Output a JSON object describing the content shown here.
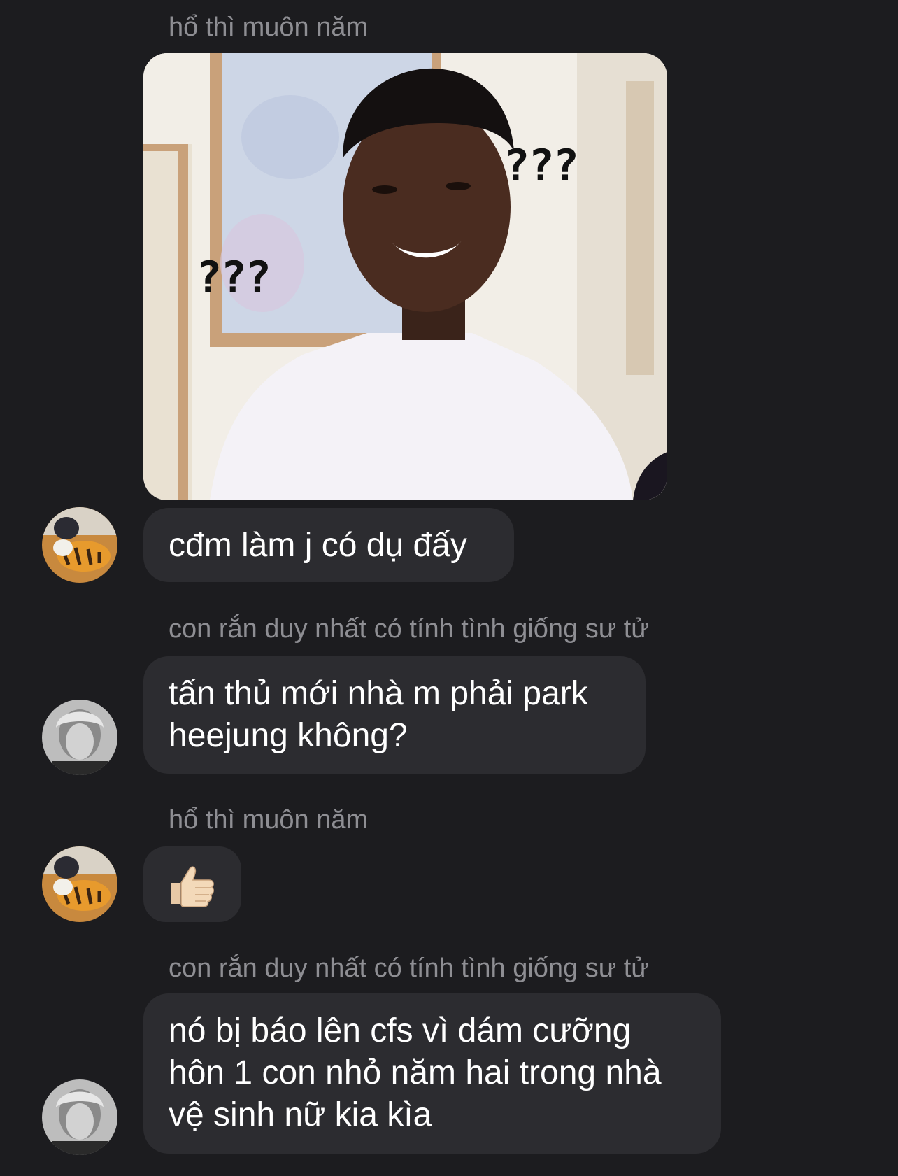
{
  "colors": {
    "background": "#1c1c1f",
    "bubble": "#2c2c30",
    "sender_name": "#8e8e93",
    "message_text": "#ffffff"
  },
  "messages": [
    {
      "sender": "hổ thì muôn năm",
      "type": "image",
      "image_captions": [
        "???",
        "???"
      ]
    },
    {
      "type": "text",
      "text": "cđm làm j có dụ đấy"
    },
    {
      "sender": "con rắn duy nhất có tính tình giống sư tử",
      "type": "text",
      "lines": [
        "tấn thủ mới nhà m phải park",
        "heejung không?"
      ]
    },
    {
      "sender": "hổ thì muôn năm",
      "type": "emoji",
      "icon": "thumbs-up-icon"
    },
    {
      "sender": "con rắn duy nhất có tính tình giống sư tử",
      "type": "text",
      "lines": [
        "nó bị báo lên cfs vì dám cưỡng",
        "hôn 1 con nhỏ năm hai trong nhà",
        "vệ sinh nữ kia kìa"
      ]
    }
  ]
}
